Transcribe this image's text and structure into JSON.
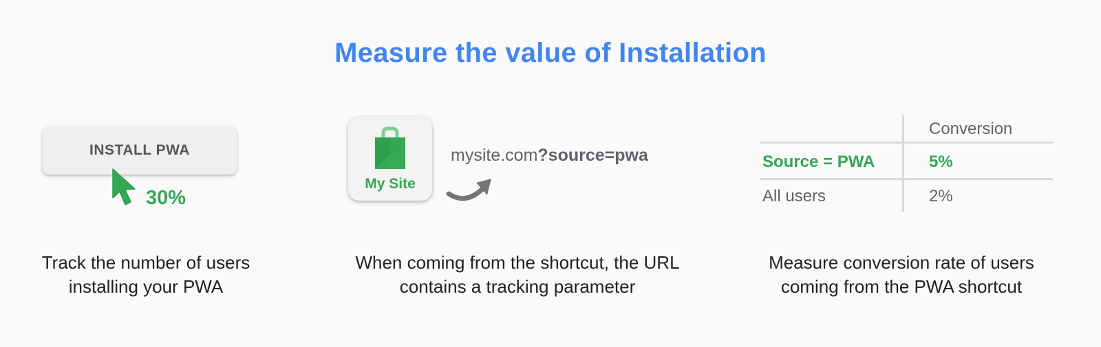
{
  "title": "Measure the value of Installation",
  "install": {
    "button_label": "INSTALL PWA",
    "percent": "30%",
    "icon": "cursor-pointer-icon"
  },
  "shortcut": {
    "app_label": "My Site",
    "app_icon": "shopping-bag-icon",
    "url_prefix": "mysite.com",
    "url_param": "?source=pwa",
    "arrow_icon": "curved-arrow-icon"
  },
  "conversion_table": {
    "header": "Conversion",
    "rows": [
      {
        "label": "Source = PWA",
        "value": "5%"
      },
      {
        "label": "All users",
        "value": "2%"
      }
    ]
  },
  "captions": {
    "col1": [
      "Track the number of users",
      "installing your PWA"
    ],
    "col2": [
      "When coming from the shortcut, the URL",
      "contains a tracking parameter"
    ],
    "col3": [
      "Measure conversion rate of users",
      "coming from the PWA shortcut"
    ]
  },
  "colors": {
    "title_blue": "#4285f4",
    "green": "#34a853",
    "gray_text": "#5f6368",
    "caption_text": "#202124"
  }
}
